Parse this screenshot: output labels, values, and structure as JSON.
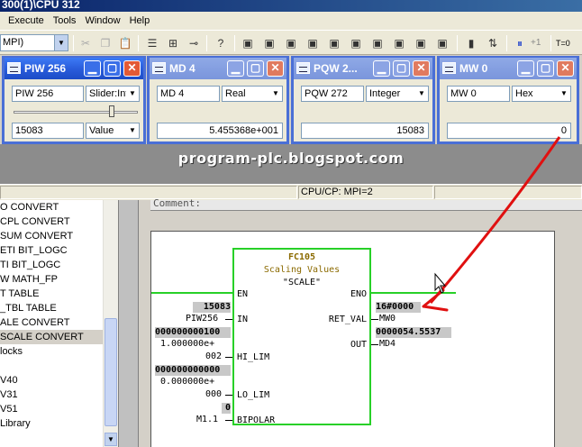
{
  "window": {
    "title": "300(1)\\CPU 312"
  },
  "menu": [
    "Execute",
    "Tools",
    "Window",
    "Help"
  ],
  "toolbar": {
    "mpi_combo": "MPI)",
    "plus_one": "+1",
    "t0": "T=0"
  },
  "var_windows": [
    {
      "title": "PIW   256",
      "address": "PIW  256",
      "format": "Slider:Int",
      "value": "15083",
      "display": "Value",
      "slider_fraction": 0.8
    },
    {
      "title": "MD     4",
      "address": "MD     4",
      "format": "Real",
      "value": "5.455368e+001"
    },
    {
      "title": "PQW   2...",
      "address": "PQW  272",
      "format": "Integer",
      "value": "15083"
    },
    {
      "title": "MW     0",
      "address": "MW     0",
      "format": "Hex",
      "value": "0"
    }
  ],
  "watermark": "program-plc.blogspot.com",
  "status": {
    "cpu": "CPU/CP:  MPI=2"
  },
  "tree": [
    {
      "label": "O   CONVERT"
    },
    {
      "label": "CPL  CONVERT"
    },
    {
      "label": "SUM  CONVERT"
    },
    {
      "label": "ETI  BIT_LOGC"
    },
    {
      "label": "TI  BIT_LOGC"
    },
    {
      "label": "W   MATH_FP"
    },
    {
      "label": "T   TABLE"
    },
    {
      "label": "_TBL  TABLE"
    },
    {
      "label": "ALE  CONVERT"
    },
    {
      "label": "SCALE  CONVERT",
      "selected": true
    },
    {
      "label": "locks"
    },
    {
      "label": ""
    },
    {
      "label": "V40"
    },
    {
      "label": "V31"
    },
    {
      "label": "V51"
    },
    {
      "label": "Library"
    }
  ],
  "editor": {
    "comment": "Comment:",
    "block": {
      "name": "FC105",
      "title": "Scaling Values",
      "symbol": "\"SCALE\"",
      "pins_in": [
        "EN",
        "IN",
        "HI_LIM",
        "LO_LIM",
        "BIPOLAR"
      ],
      "pins_out": [
        "ENO",
        "RET_VAL",
        "OUT"
      ]
    },
    "inputs": {
      "in_value": "15083",
      "in_addr": "PIW256",
      "hi_value": "000000000100",
      "hi_real": "1.000000e+",
      "hi_addr": "002",
      "lo_value": "000000000000",
      "lo_real": "0.000000e+",
      "lo_addr": "000",
      "bipolar_value": "0",
      "bipolar_addr": "M1.1"
    },
    "outputs": {
      "ret_value": "16#0000",
      "ret_addr": "MW0",
      "out_value": "0000054.5537",
      "out_addr": "MD4"
    }
  },
  "colors": {
    "accent_blue": "#2a5ddc",
    "block_green": "#28d028",
    "arrow_red": "#e01010"
  }
}
